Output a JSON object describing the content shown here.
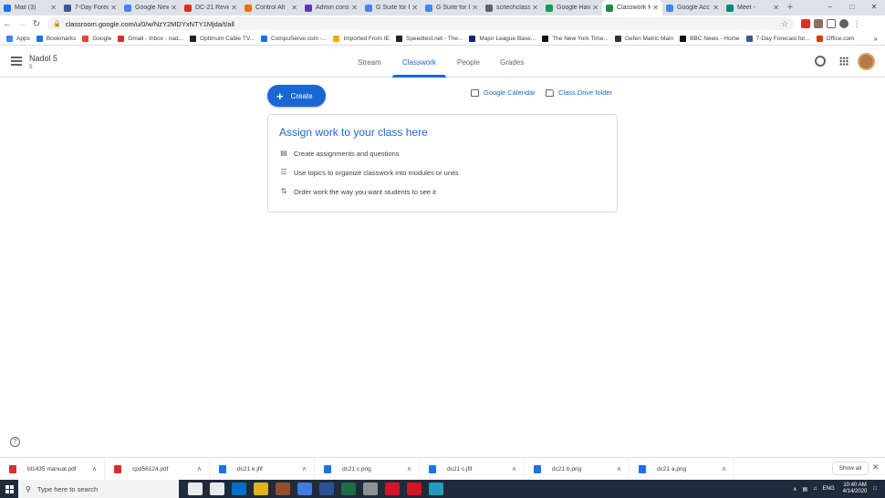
{
  "browser": {
    "tabs": [
      {
        "title": "Mail (3)",
        "color": "#1a73e8",
        "active": false
      },
      {
        "title": "7-Day Forec",
        "color": "#3b5998",
        "active": false
      },
      {
        "title": "Google New",
        "color": "#4285f4",
        "active": false
      },
      {
        "title": "DC-21 Revie",
        "color": "#d93025",
        "active": false
      },
      {
        "title": "Control Alt",
        "color": "#e8710a",
        "active": false
      },
      {
        "title": "Admin conso",
        "color": "#5e35b1",
        "active": false
      },
      {
        "title": "G Suite for E",
        "color": "#4285f4",
        "active": false
      },
      {
        "title": "G Suite for E",
        "color": "#4285f4",
        "active": false
      },
      {
        "title": "scitechclass",
        "color": "#5f6368",
        "active": false
      },
      {
        "title": "Google Han",
        "color": "#0f9d58",
        "active": false
      },
      {
        "title": "Classwork fo",
        "color": "#1e8e3e",
        "active": true
      },
      {
        "title": "Google Acc",
        "color": "#4285f4",
        "active": false
      },
      {
        "title": "Meet -",
        "color": "#00897b",
        "active": false
      }
    ],
    "url": "classroom.google.com/u/0/w/NzY2MDYxNTY1Mjda/t/all",
    "bookmarks": [
      {
        "label": "Apps",
        "color": "#4285f4"
      },
      {
        "label": "Bookmarks",
        "color": "#1a73e8"
      },
      {
        "label": "Google",
        "color": "#ea4335"
      },
      {
        "label": "Gmail - Inbox - nad...",
        "color": "#d93025"
      },
      {
        "label": "Optimum Cable TV...",
        "color": "#222222"
      },
      {
        "label": "CompuServe.com -...",
        "color": "#1a73e8"
      },
      {
        "label": "Imported From IE",
        "color": "#f9ab00"
      },
      {
        "label": "Speedtest.net - The...",
        "color": "#222222"
      },
      {
        "label": "Major League Base...",
        "color": "#1a237e"
      },
      {
        "label": "The New York Time...",
        "color": "#111111"
      },
      {
        "label": "Gefen Matric Main",
        "color": "#333333"
      },
      {
        "label": "BBC News - Home",
        "color": "#111111"
      },
      {
        "label": "7-Day Forecast for...",
        "color": "#3b5998"
      },
      {
        "label": "Office.com",
        "color": "#d83b01"
      }
    ]
  },
  "classroom": {
    "class_name": "Nadol 5",
    "section": "5",
    "tabs": [
      "Stream",
      "Classwork",
      "People",
      "Grades"
    ],
    "active_tab": "Classwork",
    "accent": "#1967d2"
  },
  "main": {
    "create_label": "Create",
    "calendar_label": "Google Calendar",
    "drive_label": "Class Drive folder",
    "card_title": "Assign work to your class here",
    "card_rows": [
      {
        "icon": "assignment-icon",
        "text": "Create assignments and questions"
      },
      {
        "icon": "topic-icon",
        "text": "Use topics to organize classwork into modules or units"
      },
      {
        "icon": "reorder-icon",
        "text": "Order work the way you want students to see it"
      }
    ]
  },
  "downloads": {
    "items": [
      {
        "name": "bl1435 manual.pdf",
        "color": "#d93025"
      },
      {
        "name": "cpd56124.pdf",
        "color": "#d93025"
      },
      {
        "name": "dc21 e.jfif",
        "color": "#1a73e8"
      },
      {
        "name": "dc21 c.png",
        "color": "#1a73e8"
      },
      {
        "name": "dc21 c.jfif",
        "color": "#1a73e8"
      },
      {
        "name": "dc21 b.png",
        "color": "#1a73e8"
      },
      {
        "name": "dc21 a.png",
        "color": "#1a73e8"
      }
    ],
    "show_all": "Show all"
  },
  "taskbar": {
    "search_placeholder": "Type here to search",
    "apps": [
      "#ffffff",
      "#ffffff",
      "#0078d7",
      "#f3c31b",
      "#a0522d",
      "#4285f4",
      "#2b579a",
      "#1e7145",
      "#9c9c9c",
      "#e81123",
      "#e81123",
      "#22a8c9"
    ],
    "lang": "ENG",
    "time": "10:40 AM",
    "date": "4/14/2020"
  }
}
